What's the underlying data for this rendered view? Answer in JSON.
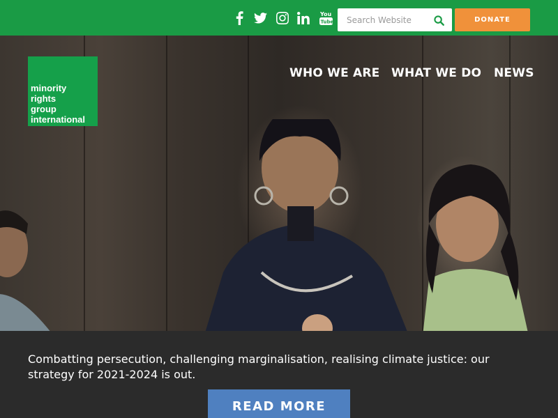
{
  "header": {
    "social": [
      {
        "name": "facebook-icon"
      },
      {
        "name": "twitter-icon"
      },
      {
        "name": "instagram-icon"
      },
      {
        "name": "linkedin-icon"
      },
      {
        "name": "youtube-icon",
        "label": "You Tube"
      }
    ],
    "search": {
      "placeholder": "Search Website",
      "value": "",
      "icon": "search-icon"
    },
    "donate_label": "DONATE",
    "colors": {
      "bar": "#1a9b45",
      "donate": "#f0913a"
    }
  },
  "logo": {
    "lines": [
      "minority",
      "rights",
      "group",
      "international"
    ],
    "color": "#15a04a"
  },
  "nav": {
    "items": [
      "WHO WE ARE",
      "WHAT WE DO",
      "NEWS"
    ]
  },
  "hero": {
    "image": "photo of a woman and children in front of a wooden wall"
  },
  "banner": {
    "text": "Combatting persecution, challenging marginalisation, realising climate justice: our strategy for 2021-2024 is out.",
    "button_label": "READ MORE",
    "button_color": "#4f80c0"
  }
}
